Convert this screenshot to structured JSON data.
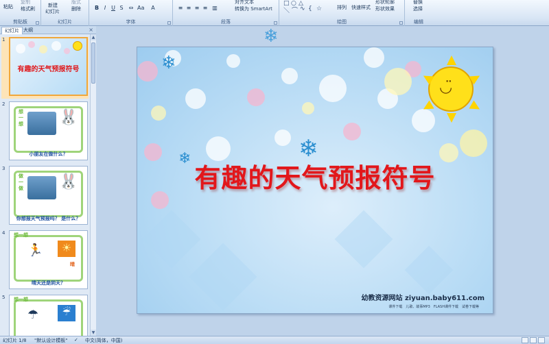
{
  "ribbon": {
    "clipboard": {
      "paste": "粘贴",
      "copy": "复制",
      "format_painter": "格式刷",
      "label": "剪贴板"
    },
    "slides": {
      "new_slide": "新建",
      "new_slide_sub": "幻灯片",
      "layout": "版式",
      "delete": "删除",
      "label": "幻灯片"
    },
    "font": {
      "label": "字体"
    },
    "paragraph": {
      "label": "段落",
      "text_direction": "对齐文本",
      "smartart": "转换为 SmartArt"
    },
    "drawing": {
      "label": "绘图",
      "arrange": "排列",
      "quick_styles": "快速样式",
      "shape_outline": "形状轮廓",
      "shape_effects": "形状效果"
    },
    "editing": {
      "label": "编辑",
      "replace": "替换",
      "select": "选择"
    }
  },
  "panel": {
    "tab_slides": "幻灯片",
    "tab_outline": "大纲",
    "close": "×"
  },
  "thumbnails": [
    {
      "num": "1",
      "title": "有趣的天气预报符号"
    },
    {
      "num": "2",
      "vertical": "想一想",
      "caption": "小朋友在做什么？"
    },
    {
      "num": "3",
      "vertical": "做一做",
      "caption": "你想报天气预报吗？ 是什么？"
    },
    {
      "num": "4",
      "header": "想一想",
      "caption": "晴天还是阴天？",
      "badge": "晴"
    },
    {
      "num": "5",
      "header": "想一想"
    }
  ],
  "slide": {
    "title": "有趣的天气预报符号",
    "site": "幼教资源网站 ziyuan.baby611.com",
    "sub": "课件下载　儿歌、故事MP3　FLASH课件下载　试卷下载等"
  },
  "status": {
    "slide_count": "幻灯片 1/8",
    "theme": "\"默认设计模板\"",
    "language": "中文(简体，中国)"
  },
  "colors": {
    "accent_title": "#e2171b",
    "selection": "#f0a73a"
  }
}
